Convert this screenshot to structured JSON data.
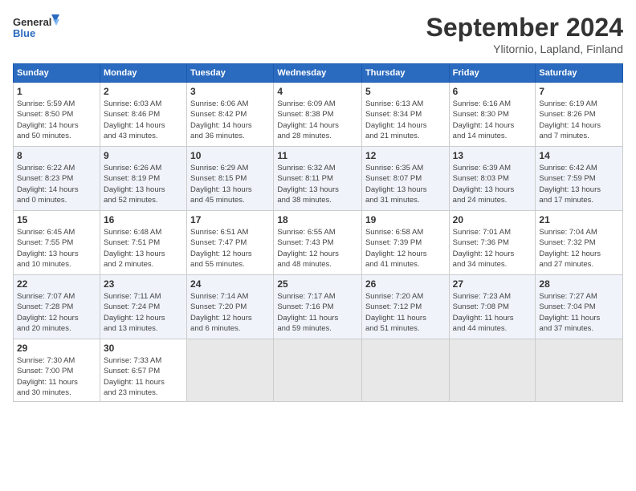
{
  "header": {
    "logo_line1": "General",
    "logo_line2": "Blue",
    "month_title": "September 2024",
    "location": "Ylitornio, Lapland, Finland"
  },
  "days_of_week": [
    "Sunday",
    "Monday",
    "Tuesday",
    "Wednesday",
    "Thursday",
    "Friday",
    "Saturday"
  ],
  "weeks": [
    [
      {
        "day": "1",
        "info": "Sunrise: 5:59 AM\nSunset: 8:50 PM\nDaylight: 14 hours\nand 50 minutes."
      },
      {
        "day": "2",
        "info": "Sunrise: 6:03 AM\nSunset: 8:46 PM\nDaylight: 14 hours\nand 43 minutes."
      },
      {
        "day": "3",
        "info": "Sunrise: 6:06 AM\nSunset: 8:42 PM\nDaylight: 14 hours\nand 36 minutes."
      },
      {
        "day": "4",
        "info": "Sunrise: 6:09 AM\nSunset: 8:38 PM\nDaylight: 14 hours\nand 28 minutes."
      },
      {
        "day": "5",
        "info": "Sunrise: 6:13 AM\nSunset: 8:34 PM\nDaylight: 14 hours\nand 21 minutes."
      },
      {
        "day": "6",
        "info": "Sunrise: 6:16 AM\nSunset: 8:30 PM\nDaylight: 14 hours\nand 14 minutes."
      },
      {
        "day": "7",
        "info": "Sunrise: 6:19 AM\nSunset: 8:26 PM\nDaylight: 14 hours\nand 7 minutes."
      }
    ],
    [
      {
        "day": "8",
        "info": "Sunrise: 6:22 AM\nSunset: 8:23 PM\nDaylight: 14 hours\nand 0 minutes."
      },
      {
        "day": "9",
        "info": "Sunrise: 6:26 AM\nSunset: 8:19 PM\nDaylight: 13 hours\nand 52 minutes."
      },
      {
        "day": "10",
        "info": "Sunrise: 6:29 AM\nSunset: 8:15 PM\nDaylight: 13 hours\nand 45 minutes."
      },
      {
        "day": "11",
        "info": "Sunrise: 6:32 AM\nSunset: 8:11 PM\nDaylight: 13 hours\nand 38 minutes."
      },
      {
        "day": "12",
        "info": "Sunrise: 6:35 AM\nSunset: 8:07 PM\nDaylight: 13 hours\nand 31 minutes."
      },
      {
        "day": "13",
        "info": "Sunrise: 6:39 AM\nSunset: 8:03 PM\nDaylight: 13 hours\nand 24 minutes."
      },
      {
        "day": "14",
        "info": "Sunrise: 6:42 AM\nSunset: 7:59 PM\nDaylight: 13 hours\nand 17 minutes."
      }
    ],
    [
      {
        "day": "15",
        "info": "Sunrise: 6:45 AM\nSunset: 7:55 PM\nDaylight: 13 hours\nand 10 minutes."
      },
      {
        "day": "16",
        "info": "Sunrise: 6:48 AM\nSunset: 7:51 PM\nDaylight: 13 hours\nand 2 minutes."
      },
      {
        "day": "17",
        "info": "Sunrise: 6:51 AM\nSunset: 7:47 PM\nDaylight: 12 hours\nand 55 minutes."
      },
      {
        "day": "18",
        "info": "Sunrise: 6:55 AM\nSunset: 7:43 PM\nDaylight: 12 hours\nand 48 minutes."
      },
      {
        "day": "19",
        "info": "Sunrise: 6:58 AM\nSunset: 7:39 PM\nDaylight: 12 hours\nand 41 minutes."
      },
      {
        "day": "20",
        "info": "Sunrise: 7:01 AM\nSunset: 7:36 PM\nDaylight: 12 hours\nand 34 minutes."
      },
      {
        "day": "21",
        "info": "Sunrise: 7:04 AM\nSunset: 7:32 PM\nDaylight: 12 hours\nand 27 minutes."
      }
    ],
    [
      {
        "day": "22",
        "info": "Sunrise: 7:07 AM\nSunset: 7:28 PM\nDaylight: 12 hours\nand 20 minutes."
      },
      {
        "day": "23",
        "info": "Sunrise: 7:11 AM\nSunset: 7:24 PM\nDaylight: 12 hours\nand 13 minutes."
      },
      {
        "day": "24",
        "info": "Sunrise: 7:14 AM\nSunset: 7:20 PM\nDaylight: 12 hours\nand 6 minutes."
      },
      {
        "day": "25",
        "info": "Sunrise: 7:17 AM\nSunset: 7:16 PM\nDaylight: 11 hours\nand 59 minutes."
      },
      {
        "day": "26",
        "info": "Sunrise: 7:20 AM\nSunset: 7:12 PM\nDaylight: 11 hours\nand 51 minutes."
      },
      {
        "day": "27",
        "info": "Sunrise: 7:23 AM\nSunset: 7:08 PM\nDaylight: 11 hours\nand 44 minutes."
      },
      {
        "day": "28",
        "info": "Sunrise: 7:27 AM\nSunset: 7:04 PM\nDaylight: 11 hours\nand 37 minutes."
      }
    ],
    [
      {
        "day": "29",
        "info": "Sunrise: 7:30 AM\nSunset: 7:00 PM\nDaylight: 11 hours\nand 30 minutes."
      },
      {
        "day": "30",
        "info": "Sunrise: 7:33 AM\nSunset: 6:57 PM\nDaylight: 11 hours\nand 23 minutes."
      },
      {
        "day": "",
        "info": ""
      },
      {
        "day": "",
        "info": ""
      },
      {
        "day": "",
        "info": ""
      },
      {
        "day": "",
        "info": ""
      },
      {
        "day": "",
        "info": ""
      }
    ]
  ]
}
